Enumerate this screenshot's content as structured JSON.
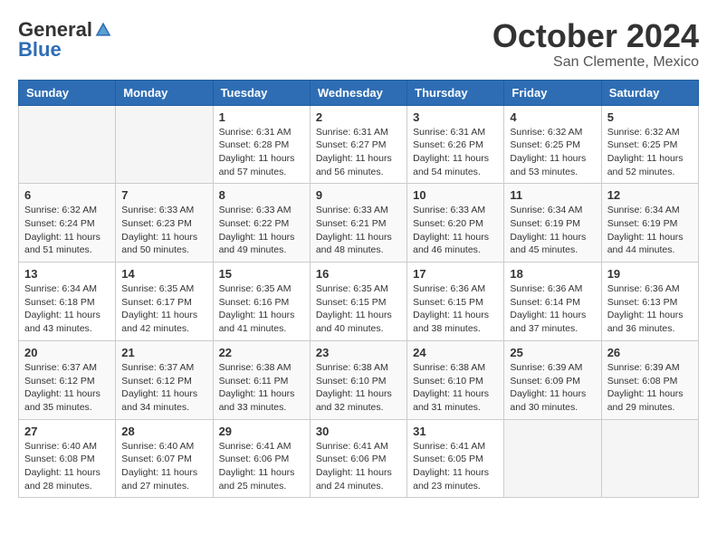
{
  "header": {
    "logo_general": "General",
    "logo_blue": "Blue",
    "month": "October 2024",
    "location": "San Clemente, Mexico"
  },
  "weekdays": [
    "Sunday",
    "Monday",
    "Tuesday",
    "Wednesday",
    "Thursday",
    "Friday",
    "Saturday"
  ],
  "weeks": [
    [
      {
        "day": "",
        "sunrise": "",
        "sunset": "",
        "daylight": ""
      },
      {
        "day": "",
        "sunrise": "",
        "sunset": "",
        "daylight": ""
      },
      {
        "day": "1",
        "sunrise": "Sunrise: 6:31 AM",
        "sunset": "Sunset: 6:28 PM",
        "daylight": "Daylight: 11 hours and 57 minutes."
      },
      {
        "day": "2",
        "sunrise": "Sunrise: 6:31 AM",
        "sunset": "Sunset: 6:27 PM",
        "daylight": "Daylight: 11 hours and 56 minutes."
      },
      {
        "day": "3",
        "sunrise": "Sunrise: 6:31 AM",
        "sunset": "Sunset: 6:26 PM",
        "daylight": "Daylight: 11 hours and 54 minutes."
      },
      {
        "day": "4",
        "sunrise": "Sunrise: 6:32 AM",
        "sunset": "Sunset: 6:25 PM",
        "daylight": "Daylight: 11 hours and 53 minutes."
      },
      {
        "day": "5",
        "sunrise": "Sunrise: 6:32 AM",
        "sunset": "Sunset: 6:25 PM",
        "daylight": "Daylight: 11 hours and 52 minutes."
      }
    ],
    [
      {
        "day": "6",
        "sunrise": "Sunrise: 6:32 AM",
        "sunset": "Sunset: 6:24 PM",
        "daylight": "Daylight: 11 hours and 51 minutes."
      },
      {
        "day": "7",
        "sunrise": "Sunrise: 6:33 AM",
        "sunset": "Sunset: 6:23 PM",
        "daylight": "Daylight: 11 hours and 50 minutes."
      },
      {
        "day": "8",
        "sunrise": "Sunrise: 6:33 AM",
        "sunset": "Sunset: 6:22 PM",
        "daylight": "Daylight: 11 hours and 49 minutes."
      },
      {
        "day": "9",
        "sunrise": "Sunrise: 6:33 AM",
        "sunset": "Sunset: 6:21 PM",
        "daylight": "Daylight: 11 hours and 48 minutes."
      },
      {
        "day": "10",
        "sunrise": "Sunrise: 6:33 AM",
        "sunset": "Sunset: 6:20 PM",
        "daylight": "Daylight: 11 hours and 46 minutes."
      },
      {
        "day": "11",
        "sunrise": "Sunrise: 6:34 AM",
        "sunset": "Sunset: 6:19 PM",
        "daylight": "Daylight: 11 hours and 45 minutes."
      },
      {
        "day": "12",
        "sunrise": "Sunrise: 6:34 AM",
        "sunset": "Sunset: 6:19 PM",
        "daylight": "Daylight: 11 hours and 44 minutes."
      }
    ],
    [
      {
        "day": "13",
        "sunrise": "Sunrise: 6:34 AM",
        "sunset": "Sunset: 6:18 PM",
        "daylight": "Daylight: 11 hours and 43 minutes."
      },
      {
        "day": "14",
        "sunrise": "Sunrise: 6:35 AM",
        "sunset": "Sunset: 6:17 PM",
        "daylight": "Daylight: 11 hours and 42 minutes."
      },
      {
        "day": "15",
        "sunrise": "Sunrise: 6:35 AM",
        "sunset": "Sunset: 6:16 PM",
        "daylight": "Daylight: 11 hours and 41 minutes."
      },
      {
        "day": "16",
        "sunrise": "Sunrise: 6:35 AM",
        "sunset": "Sunset: 6:15 PM",
        "daylight": "Daylight: 11 hours and 40 minutes."
      },
      {
        "day": "17",
        "sunrise": "Sunrise: 6:36 AM",
        "sunset": "Sunset: 6:15 PM",
        "daylight": "Daylight: 11 hours and 38 minutes."
      },
      {
        "day": "18",
        "sunrise": "Sunrise: 6:36 AM",
        "sunset": "Sunset: 6:14 PM",
        "daylight": "Daylight: 11 hours and 37 minutes."
      },
      {
        "day": "19",
        "sunrise": "Sunrise: 6:36 AM",
        "sunset": "Sunset: 6:13 PM",
        "daylight": "Daylight: 11 hours and 36 minutes."
      }
    ],
    [
      {
        "day": "20",
        "sunrise": "Sunrise: 6:37 AM",
        "sunset": "Sunset: 6:12 PM",
        "daylight": "Daylight: 11 hours and 35 minutes."
      },
      {
        "day": "21",
        "sunrise": "Sunrise: 6:37 AM",
        "sunset": "Sunset: 6:12 PM",
        "daylight": "Daylight: 11 hours and 34 minutes."
      },
      {
        "day": "22",
        "sunrise": "Sunrise: 6:38 AM",
        "sunset": "Sunset: 6:11 PM",
        "daylight": "Daylight: 11 hours and 33 minutes."
      },
      {
        "day": "23",
        "sunrise": "Sunrise: 6:38 AM",
        "sunset": "Sunset: 6:10 PM",
        "daylight": "Daylight: 11 hours and 32 minutes."
      },
      {
        "day": "24",
        "sunrise": "Sunrise: 6:38 AM",
        "sunset": "Sunset: 6:10 PM",
        "daylight": "Daylight: 11 hours and 31 minutes."
      },
      {
        "day": "25",
        "sunrise": "Sunrise: 6:39 AM",
        "sunset": "Sunset: 6:09 PM",
        "daylight": "Daylight: 11 hours and 30 minutes."
      },
      {
        "day": "26",
        "sunrise": "Sunrise: 6:39 AM",
        "sunset": "Sunset: 6:08 PM",
        "daylight": "Daylight: 11 hours and 29 minutes."
      }
    ],
    [
      {
        "day": "27",
        "sunrise": "Sunrise: 6:40 AM",
        "sunset": "Sunset: 6:08 PM",
        "daylight": "Daylight: 11 hours and 28 minutes."
      },
      {
        "day": "28",
        "sunrise": "Sunrise: 6:40 AM",
        "sunset": "Sunset: 6:07 PM",
        "daylight": "Daylight: 11 hours and 27 minutes."
      },
      {
        "day": "29",
        "sunrise": "Sunrise: 6:41 AM",
        "sunset": "Sunset: 6:06 PM",
        "daylight": "Daylight: 11 hours and 25 minutes."
      },
      {
        "day": "30",
        "sunrise": "Sunrise: 6:41 AM",
        "sunset": "Sunset: 6:06 PM",
        "daylight": "Daylight: 11 hours and 24 minutes."
      },
      {
        "day": "31",
        "sunrise": "Sunrise: 6:41 AM",
        "sunset": "Sunset: 6:05 PM",
        "daylight": "Daylight: 11 hours and 23 minutes."
      },
      {
        "day": "",
        "sunrise": "",
        "sunset": "",
        "daylight": ""
      },
      {
        "day": "",
        "sunrise": "",
        "sunset": "",
        "daylight": ""
      }
    ]
  ]
}
